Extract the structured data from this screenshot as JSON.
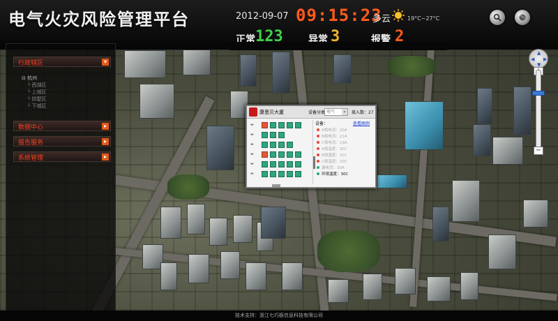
{
  "app": {
    "title": "电气火灾风险管理平台"
  },
  "header": {
    "date": "2012-09-07",
    "time": "09:15:23",
    "weather": "多云",
    "temperature": "19°C~27°C",
    "icons": [
      "search-icon",
      "globe-icon"
    ]
  },
  "stats": [
    {
      "label": "正常",
      "value": "123",
      "color": "#3fd04a"
    },
    {
      "label": "异常",
      "value": "3",
      "color": "#f0b52a"
    },
    {
      "label": "报警",
      "value": "2",
      "color": "#ff5a1e"
    }
  ],
  "sidebar": {
    "menu": [
      "行政辖区",
      "数据中心",
      "报告服务",
      "系统管理"
    ],
    "tree_root": "杭州",
    "tree_children": [
      "西湖区",
      "上城区",
      "拱墅区",
      "下城区"
    ]
  },
  "popup": {
    "building": "康恩贝大厦",
    "category_label": "设备分类",
    "category_value": "电气",
    "access_label": "接入数：",
    "access_value": "27",
    "device_title": "设备：",
    "device_link": "查看图例",
    "readings": [
      "A相电流：20A",
      "B相电流：21A",
      "C相电流：19A",
      "A相温度：30C",
      "B相温度：31C",
      "C相温度：30C",
      "漏电流：30A",
      "环境温度：30C"
    ]
  },
  "footer": {
    "text": "技术支持：浙江七巧板信息科技有限公司"
  }
}
